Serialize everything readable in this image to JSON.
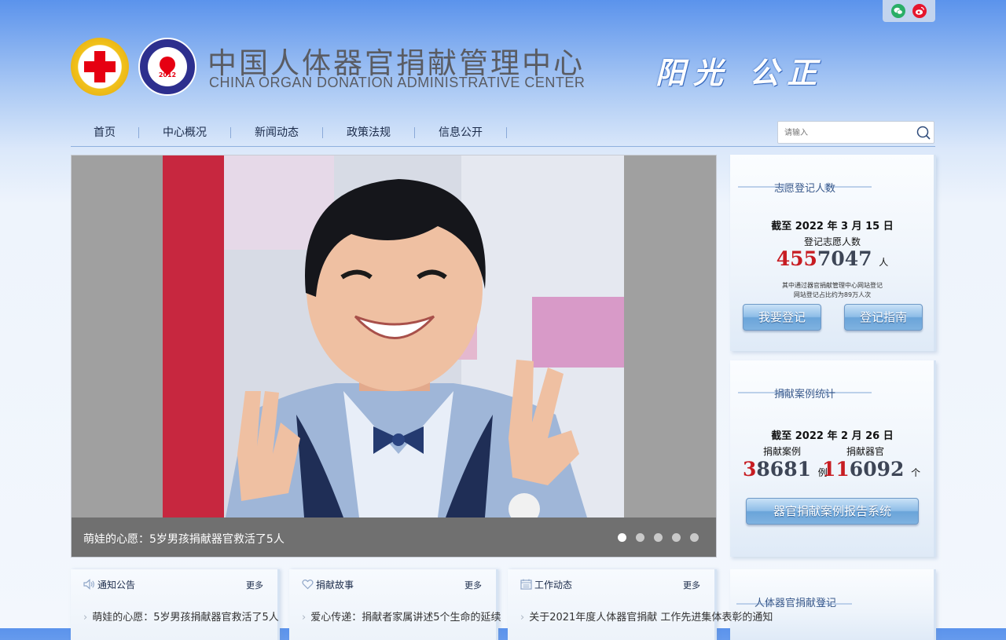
{
  "header": {
    "title_cn": "中国人体器官捐献管理中心",
    "title_en": "CHINA ORGAN DONATION ADMINISTRATIVE CENTER",
    "motto": "阳光 公正",
    "logo_cod_year": "2012"
  },
  "social": {
    "icons": [
      "wechat-icon",
      "weibo-icon"
    ]
  },
  "nav": {
    "items": [
      "首页",
      "中心概况",
      "新闻动态",
      "政策法规",
      "信息公开"
    ]
  },
  "search": {
    "placeholder": "请输入"
  },
  "carousel": {
    "caption": "萌娃的心愿：5岁男孩捐献器官救活了5人",
    "slide_count": 5,
    "active_index": 0
  },
  "registry_panel": {
    "title": "志愿登记人数",
    "date_prefix": "截至",
    "date_year": "2022",
    "date_y": "年",
    "date_month": "3",
    "date_m": "月",
    "date_day": "15",
    "date_d": "日",
    "label": "登记志愿人数",
    "number_red": "455",
    "number_rest": "7047",
    "unit": "人",
    "note_line1": "其中通过器官捐献管理中心网站登记",
    "note_line2": "网站登记占比约为89万人次",
    "btn_register": "我要登记",
    "btn_guide": "登记指南"
  },
  "donation_panel": {
    "title": "捐献案例统计",
    "date_prefix": "截至",
    "date_year": "2022",
    "date_y": "年",
    "date_month": "2",
    "date_m": "月",
    "date_day": "26",
    "date_d": "日",
    "left_label": "捐献案例",
    "left_red": "3",
    "left_rest": "8681",
    "left_unit": "例",
    "right_label": "捐献器官",
    "right_red": "11",
    "right_rest": "6092",
    "right_unit": "个",
    "btn_report": "器官捐献案例报告系统"
  },
  "third_panel": {
    "title": "人体器官捐献登记"
  },
  "columns": [
    {
      "title": "通知公告",
      "icon": "speaker-icon",
      "more": "更多",
      "first_item": "萌娃的心愿：5岁男孩捐献器官救活了5人"
    },
    {
      "title": "捐献故事",
      "icon": "heart-icon",
      "more": "更多",
      "first_item": "爱心传递：捐献者家属讲述5个生命的延续"
    },
    {
      "title": "工作动态",
      "icon": "calendar-icon",
      "more": "更多",
      "first_item": "关于2021年度人体器官捐献 工作先进集体表彰的通知"
    }
  ]
}
